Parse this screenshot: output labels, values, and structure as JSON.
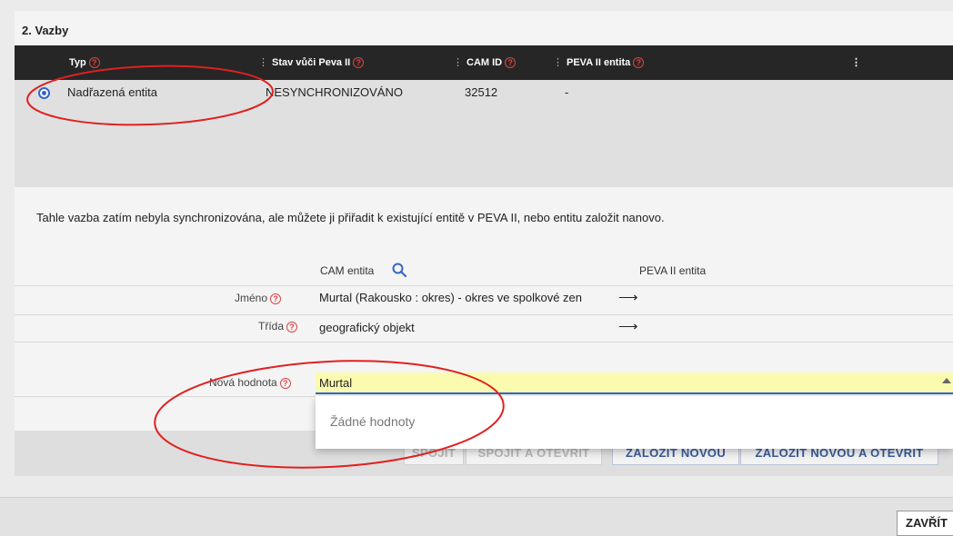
{
  "section": {
    "title": "2. Vazby"
  },
  "grid": {
    "columns": [
      {
        "label": "Typ",
        "has_help": true
      },
      {
        "label": "Stav vůči Peva II",
        "has_help": true
      },
      {
        "label": "CAM ID",
        "has_help": true
      },
      {
        "label": "PEVA II entita",
        "has_help": true
      }
    ],
    "more_menu_icon": "vertical-ellipsis-icon",
    "rows": [
      {
        "type": "Nadřazená entita",
        "status": "NESYNCHRONIZOVÁNO",
        "cam_id": "32512",
        "peva_entity": "-",
        "selected": true
      }
    ]
  },
  "info_text": "Tahle vazba zatím nebyla synchronizována, ale můžete ji přiřadit k existující entitě v PEVA II, nebo entitu založit nanovo.",
  "compare": {
    "cam_header": "CAM entita",
    "peva_header": "PEVA II entita",
    "search_icon": "search-icon",
    "rows": [
      {
        "label": "Jméno",
        "value": "Murtal (Rakousko : okres) - okres ve spolkové zen"
      },
      {
        "label": "Třída",
        "value": "geografický objekt"
      }
    ],
    "arrow_icon": "arrow-right-icon"
  },
  "new_value": {
    "label": "Nová hodnota",
    "value": "Murtal",
    "dropdown_empty": "Žádné hodnoty"
  },
  "actions": {
    "connect": "SPOJIT",
    "connect_open": "SPOJIT A OTEVŘÍT",
    "create_new": "ZALOŽIT NOVOU",
    "create_new_open": "ZALOŽIT NOVOU A OTEVŘÍT"
  },
  "close_label": "ZAVŘÍT",
  "colors": {
    "accent": "#3366cc",
    "help": "#e04545",
    "header_bg": "#262626",
    "input_bg": "#fbfbb0",
    "annotation": "#e02020"
  }
}
